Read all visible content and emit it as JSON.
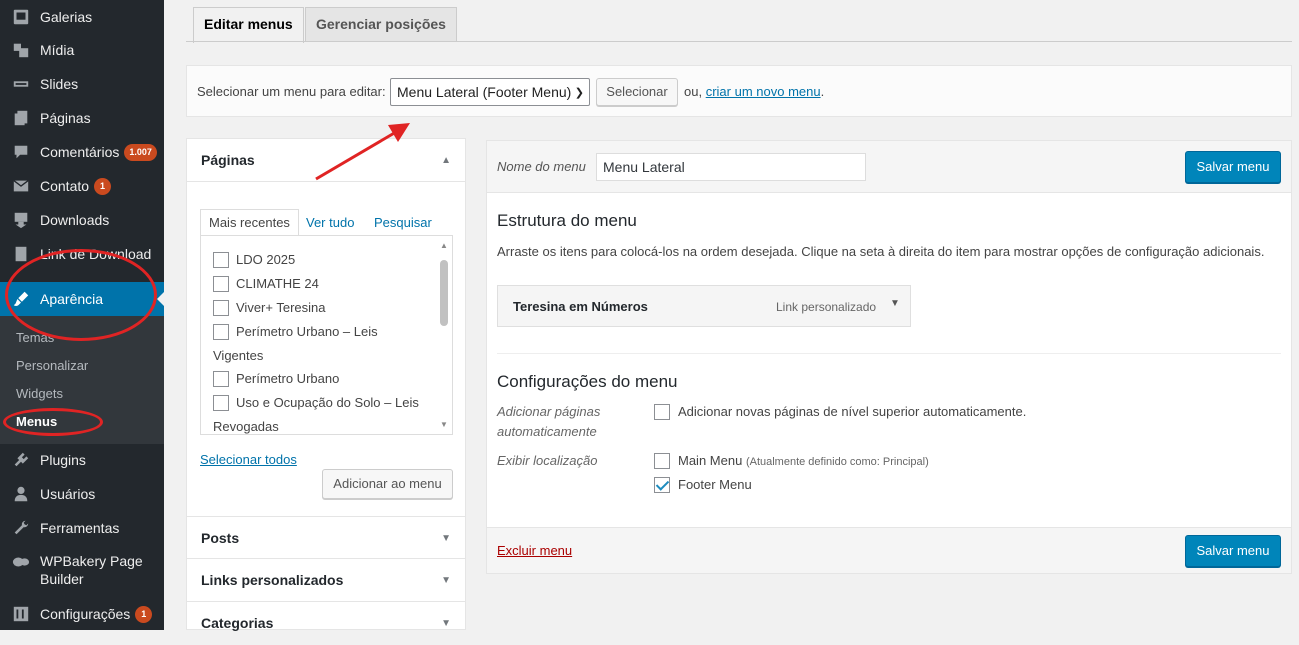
{
  "sidebar": {
    "items": [
      {
        "label": "Galerias",
        "icon": "gallery-icon"
      },
      {
        "label": "Mídia",
        "icon": "media-icon"
      },
      {
        "label": "Slides",
        "icon": "slides-icon"
      },
      {
        "label": "Páginas",
        "icon": "pages-icon"
      },
      {
        "label": "Comentários",
        "icon": "comments-icon",
        "badge": "1.007"
      },
      {
        "label": "Contato",
        "icon": "mail-icon",
        "badge": "1"
      },
      {
        "label": "Downloads",
        "icon": "download-icon"
      },
      {
        "label": "Link de Download",
        "icon": "link-download-icon"
      },
      {
        "label": "Aparência",
        "icon": "appearance-icon"
      },
      {
        "label": "Plugins",
        "icon": "plugins-icon"
      },
      {
        "label": "Usuários",
        "icon": "users-icon"
      },
      {
        "label": "Ferramentas",
        "icon": "tools-icon"
      },
      {
        "label": "WPBakery Page Builder",
        "icon": "wpbakery-icon"
      },
      {
        "label": "Configurações",
        "icon": "settings-icon",
        "badge": "1"
      }
    ],
    "submenu": [
      "Temas",
      "Personalizar",
      "Widgets",
      "Menus"
    ],
    "active_color": "#0073aa"
  },
  "tabs": {
    "edit": "Editar menus",
    "manage": "Gerenciar posições"
  },
  "select_bar": {
    "label": "Selecionar um menu para editar:",
    "selected": "Menu Lateral (Footer Menu)",
    "button": "Selecionar",
    "or_text": "ou,",
    "create_link": "criar um novo menu",
    "create_suffix": "."
  },
  "left_panel": {
    "pages_title": "Páginas",
    "tabs": [
      "Mais recentes",
      "Ver tudo",
      "Pesquisar"
    ],
    "pages": [
      "LDO 2025",
      "CLIMATHE 24",
      "Viver+ Teresina",
      "Perímetro Urbano – Leis",
      "Vigentes",
      "Perímetro Urbano",
      "Uso e Ocupação do Solo – Leis",
      "Revogadas"
    ],
    "select_all": "Selecionar todos",
    "add_button": "Adicionar ao menu",
    "sections": [
      "Posts",
      "Links personalizados",
      "Categorias"
    ]
  },
  "right_panel": {
    "name_label": "Nome do menu",
    "name_value": "Menu Lateral",
    "save_button": "Salvar menu",
    "structure_title": "Estrutura do menu",
    "structure_desc": "Arraste os itens para colocá-los na ordem desejada. Clique na seta à direita do item para mostrar opções de configuração adicionais.",
    "menu_item": {
      "title": "Teresina em Números",
      "type": "Link personalizado"
    },
    "settings_title": "Configurações do menu",
    "auto_add_label": [
      "Adicionar páginas",
      "automaticamente"
    ],
    "auto_add_option": "Adicionar novas páginas de nível superior automaticamente.",
    "location_label": "Exibir localização",
    "locations": [
      {
        "name": "Main Menu",
        "note": "(Atualmente definido como: Principal)",
        "checked": false
      },
      {
        "name": "Footer Menu",
        "note": "",
        "checked": true
      }
    ],
    "delete_link": "Excluir menu"
  },
  "annotation_color": "#e02424"
}
